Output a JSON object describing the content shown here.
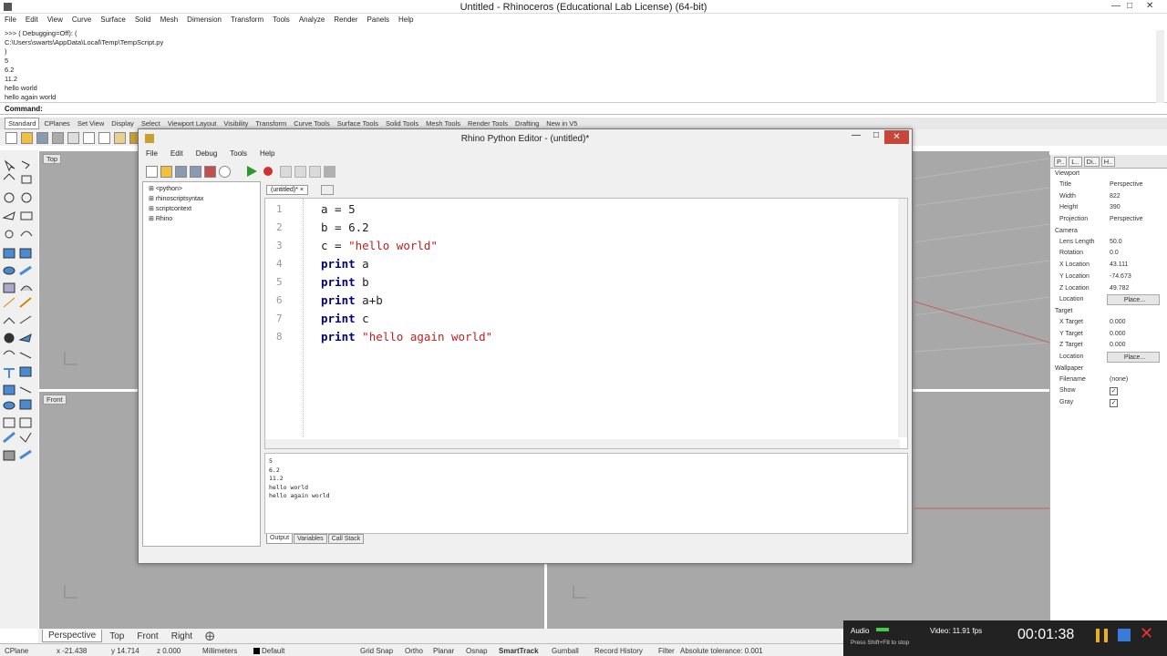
{
  "app": {
    "title": "Untitled - Rhinoceros (Educational Lab License) (64-bit)"
  },
  "menu": [
    "File",
    "Edit",
    "View",
    "Curve",
    "Surface",
    "Solid",
    "Mesh",
    "Dimension",
    "Transform",
    "Tools",
    "Analyze",
    "Render",
    "Panels",
    "Help"
  ],
  "history": [
    ">>> ( Debugging=Off): (",
    "C:\\Users\\swarts\\AppData\\Local\\Temp\\TempScript.py",
    ")",
    "5",
    "6.2",
    "11.2",
    "hello world",
    "hello again world"
  ],
  "command_label": "Command:",
  "toolbar_tabs": [
    "Standard",
    "CPlanes",
    "Set View",
    "Display",
    "Select",
    "Viewport Layout",
    "Visibility",
    "Transform",
    "Curve Tools",
    "Surface Tools",
    "Solid Tools",
    "Mesh Tools",
    "Render Tools",
    "Drafting",
    "New in V5"
  ],
  "viewports": {
    "top": "Top",
    "front": "Front"
  },
  "editor": {
    "title": "Rhino Python Editor - (untitled)*",
    "menu": [
      "File",
      "Edit",
      "Debug",
      "Tools",
      "Help"
    ],
    "tree": [
      "<python>",
      "rhinoscriptsyntax",
      "scriptcontext",
      "Rhino"
    ],
    "tab": "(untitled)*",
    "code_lines": [
      {
        "n": "1",
        "parts": [
          {
            "t": "a = 5",
            "c": "plain"
          }
        ]
      },
      {
        "n": "2",
        "parts": [
          {
            "t": "b = 6.2",
            "c": "plain"
          }
        ]
      },
      {
        "n": "3",
        "parts": [
          {
            "t": "c = ",
            "c": "plain"
          },
          {
            "t": "\"hello world\"",
            "c": "str"
          }
        ]
      },
      {
        "n": "4",
        "parts": [
          {
            "t": "print",
            "c": "kw"
          },
          {
            "t": " a",
            "c": "plain"
          }
        ]
      },
      {
        "n": "5",
        "parts": [
          {
            "t": "print",
            "c": "kw"
          },
          {
            "t": " b",
            "c": "plain"
          }
        ]
      },
      {
        "n": "6",
        "parts": [
          {
            "t": "print",
            "c": "kw"
          },
          {
            "t": " a+b",
            "c": "plain"
          }
        ]
      },
      {
        "n": "7",
        "parts": [
          {
            "t": "print",
            "c": "kw"
          },
          {
            "t": " c",
            "c": "plain"
          }
        ]
      },
      {
        "n": "8",
        "parts": [
          {
            "t": "print",
            "c": "kw"
          },
          {
            "t": " ",
            "c": "plain"
          },
          {
            "t": "\"hello again world\"",
            "c": "str"
          }
        ]
      }
    ],
    "output_lines": [
      "5",
      "6.2",
      "11.2",
      "hello world",
      "hello again world"
    ],
    "output_tabs": [
      "Output",
      "Variables",
      "Call Stack"
    ]
  },
  "properties": {
    "tabs": [
      "P..",
      "L..",
      "Di..",
      "H.."
    ],
    "viewport_section": "Viewport",
    "camera_section": "Camera",
    "target_section": "Target",
    "wallpaper_section": "Wallpaper",
    "viewport_rows": [
      {
        "k": "Title",
        "v": "Perspective"
      },
      {
        "k": "Width",
        "v": "822"
      },
      {
        "k": "Height",
        "v": "390"
      },
      {
        "k": "Projection",
        "v": "Perspective"
      }
    ],
    "camera_rows": [
      {
        "k": "Lens Length",
        "v": "50.0"
      },
      {
        "k": "Rotation",
        "v": "0.0"
      },
      {
        "k": "X Location",
        "v": "43.111"
      },
      {
        "k": "Y Location",
        "v": "-74.673"
      },
      {
        "k": "Z Location",
        "v": "49.782"
      },
      {
        "k": "Location",
        "v": "Place..."
      }
    ],
    "target_rows": [
      {
        "k": "X Target",
        "v": "0.000"
      },
      {
        "k": "Y Target",
        "v": "0.000"
      },
      {
        "k": "Z Target",
        "v": "0.000"
      },
      {
        "k": "Location",
        "v": "Place..."
      }
    ],
    "wallpaper_rows": [
      {
        "k": "Filename",
        "v": "(none)"
      },
      {
        "k": "Show",
        "v": "✓"
      },
      {
        "k": "Gray",
        "v": "✓"
      }
    ]
  },
  "view_tabs": [
    "Perspective",
    "Top",
    "Front",
    "Right"
  ],
  "status": {
    "cplane": "CPlane",
    "x": "x -21.438",
    "y": "y 14.714",
    "z": "z 0.000",
    "units": "Millimeters",
    "layer": "Default",
    "grid_snap": "Grid Snap",
    "ortho": "Ortho",
    "planar": "Planar",
    "osnap": "Osnap",
    "smarttrack": "SmartTrack",
    "gumball": "Gumball",
    "record_history": "Record History",
    "filter": "Filter",
    "tolerance": "Absolute tolerance: 0.001"
  },
  "recorder": {
    "audio": "Audio",
    "video": "Video: 11.91 fps",
    "hint": "Press Shift+F8 to stop",
    "time": "00:01:38"
  },
  "colors": {
    "accent_red": "#c8453a",
    "keyword": "#000080",
    "string": "#c02020",
    "viewport_bg": "#a8a8a8"
  }
}
